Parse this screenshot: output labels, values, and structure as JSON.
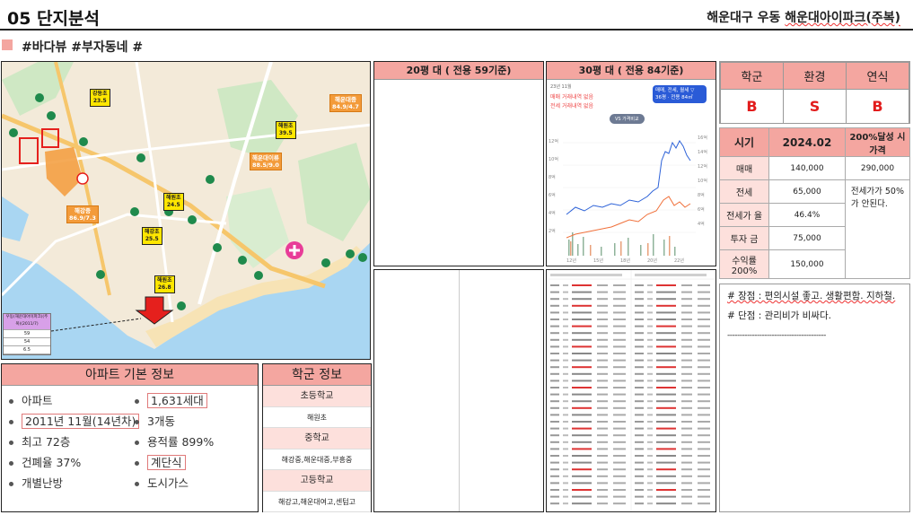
{
  "header": {
    "title": "05 단지분석",
    "location": "해운대구 우동",
    "complex": "해운대아이파크(주복)",
    "tags": "#바다뷰 #부자동네 #"
  },
  "map": {
    "labels": [
      {
        "name": "강동초",
        "value": "23.5"
      },
      {
        "name": "해운대중",
        "value": "84.9/4.7"
      },
      {
        "name": "해원초",
        "value": "39.5"
      },
      {
        "name": "해운대이류",
        "value": "88.5/9.0"
      },
      {
        "name": "해원초",
        "value": "24.5"
      },
      {
        "name": "해강중",
        "value": "86.9/7.3"
      },
      {
        "name": "해강초",
        "value": "25.5"
      },
      {
        "name": "해원초",
        "value": "26.8"
      }
    ],
    "legend": {
      "title": "우동(해운대아이파크)(주복)(2011/7)",
      "rows": [
        "59",
        "54",
        "6.5"
      ]
    }
  },
  "apt_info": {
    "title": "아파트 기본 정보",
    "items": [
      "아파트",
      "1,631세대",
      "2011년 11월(14년차)",
      "3개동",
      "최고 72층",
      "용적률 899%",
      "건폐율 37%",
      "계단식",
      "개별난방",
      "도시가스"
    ]
  },
  "school_info": {
    "title": "학군 정보",
    "rows": [
      {
        "type": "cat",
        "text": "초등학교"
      },
      {
        "type": "val",
        "text": "해원초"
      },
      {
        "type": "cat",
        "text": "중학교"
      },
      {
        "type": "val",
        "text": "해강중,해운대중,부흥중"
      },
      {
        "type": "cat",
        "text": "고등학교"
      },
      {
        "type": "val",
        "text": "해강고,해운대여고,센텀고"
      }
    ]
  },
  "panel20": {
    "title": "20평 대 ( 전용 59기준)"
  },
  "panel30": {
    "title": "30평 대 ( 전용 84기준)",
    "chart_top": "23년 11월",
    "line1": "매매 거래내역 없음",
    "line2": "전세 거래내역 없음",
    "badge1": "매매, 전세, 월세 ▽",
    "badge2": "36평 · 전용 84㎡",
    "vs": "VS 가격비교",
    "y_right": [
      "16억",
      "14억",
      "12억",
      "10억",
      "8억",
      "6억",
      "4억"
    ],
    "y_left": [
      "12억",
      "10억",
      "8억",
      "6억",
      "4억",
      "2억"
    ],
    "x_ticks": [
      "12년",
      "15년",
      "18년",
      "20년",
      "22년"
    ]
  },
  "grades": {
    "headers": [
      "학군",
      "환경",
      "연식"
    ],
    "values": [
      "B",
      "S",
      "B"
    ]
  },
  "prices": {
    "head": [
      "시기",
      "2024.02",
      "200%달성 시 가격"
    ],
    "rows": [
      {
        "label": "매매",
        "value": "140,000",
        "target": "290,000"
      },
      {
        "label": "전세",
        "value": "65,000",
        "target": "전세가가 50%가 안된다."
      },
      {
        "label": "전세가 율",
        "value": "46.4%"
      },
      {
        "label": "투자 금",
        "value": "75,000"
      },
      {
        "label": "수익률 200%",
        "value": "150,000"
      }
    ]
  },
  "notes": {
    "pro": "# 장점 : 편의시설 좋고. 생활편함. 지하철.",
    "con": "# 단점 : 관리비가 비싸다.",
    "rule": "----------------------------------------"
  },
  "colors": {
    "accent": "#f4a6a0",
    "grade_red": "#e21c1c",
    "light_pink": "#fde0dc"
  }
}
